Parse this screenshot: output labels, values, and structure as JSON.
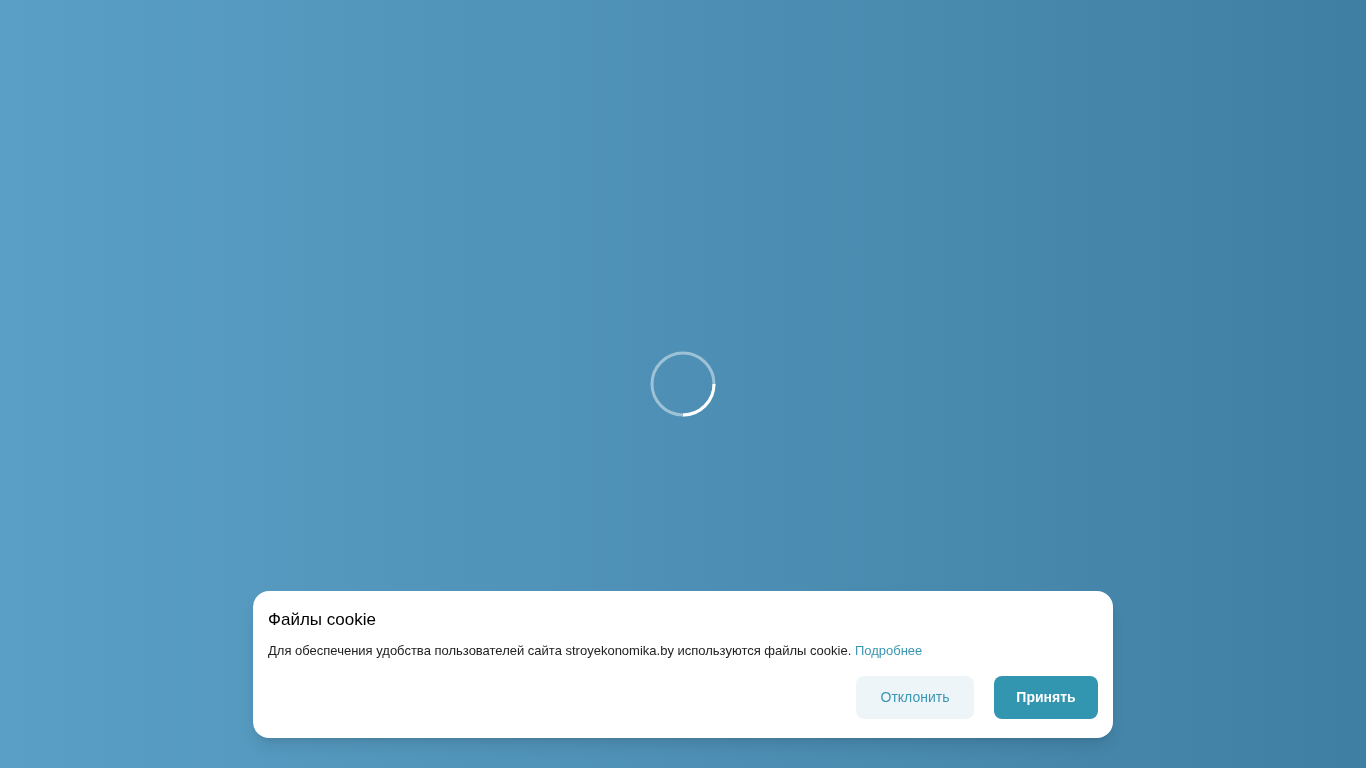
{
  "cookie_banner": {
    "title": "Файлы cookie",
    "message": "Для обеспечения удобства пользователей сайта stroyekonomika.by используются файлы cookie.",
    "link": "Подробнее",
    "buttons": [
      {
        "label": "Отклонить",
        "kind": "secondary"
      },
      {
        "label": "Принять",
        "kind": "primary"
      }
    ]
  }
}
